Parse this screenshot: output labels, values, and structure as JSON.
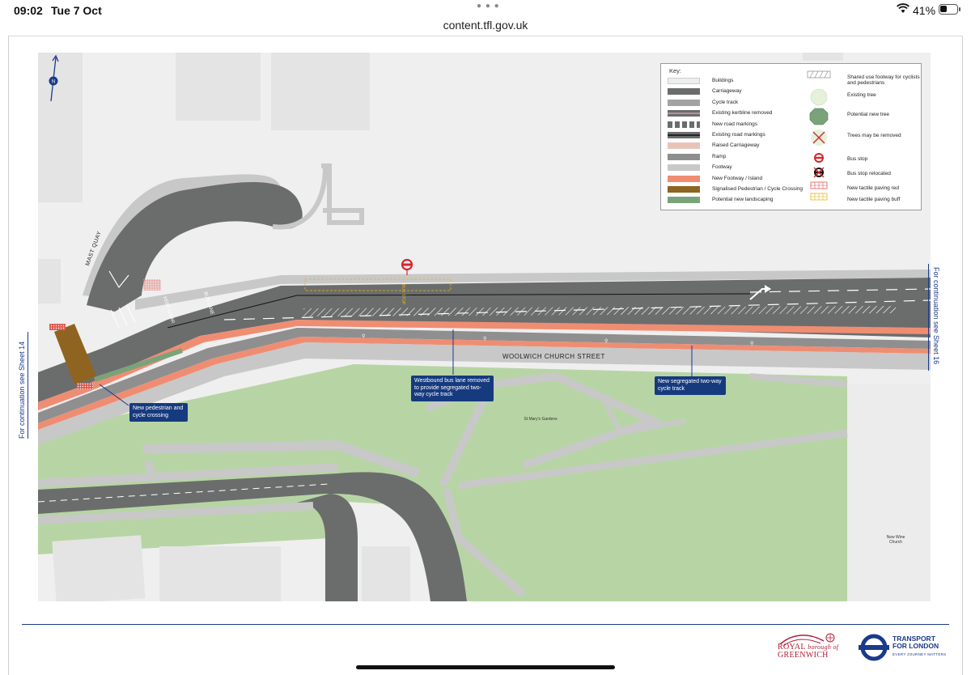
{
  "status_bar": {
    "time": "09:02",
    "date": "Tue 7 Oct",
    "battery": "41%",
    "battery_level": 0.41
  },
  "browser": {
    "url": "content.tfl.gov.uk"
  },
  "map": {
    "continuation_left": "For continuation see Sheet 14",
    "continuation_right": "For continuation see Sheet 16",
    "street_label": "WOOLWICH CHURCH STREET",
    "side_street_label": "MAST QUAY",
    "park_label": "St Mary's Gardens",
    "church_label": "New Wine Church",
    "north_label": "N",
    "road_text": {
      "bus_lane": "BUS LANE",
      "keep_clear": "KEEP CLEAR",
      "bus_stop": "BUS STOP"
    },
    "callouts": {
      "crossing": "New pedestrian and cycle crossing",
      "bus_lane_removed": "Westbound bus lane removed to provide segregated two-way cycle track",
      "cycle_track": "New segregated two-way cycle track"
    }
  },
  "key": {
    "title": "Key:",
    "left": [
      {
        "label": "Buildings",
        "color": "#eeeeee"
      },
      {
        "label": "Carriageway",
        "color": "#6b6d6c"
      },
      {
        "label": "Cycle track",
        "color": "#a3a3a3"
      },
      {
        "label": "Existing kerbline removed",
        "color": "#8e6f79"
      },
      {
        "label": "New road markings",
        "color": "#6b6d6c"
      },
      {
        "label": "Existing road markings",
        "color": "#5a5a5a"
      },
      {
        "label": "Raised Carriageway",
        "color": "#e8c4b8"
      },
      {
        "label": "Ramp",
        "color": "#8e8e8e"
      },
      {
        "label": "Footway",
        "color": "#c8c8c8"
      },
      {
        "label": "New Footway / Island",
        "color": "#ef8d73"
      },
      {
        "label": "Signalised Pedestrian / Cycle Crossing",
        "color": "#8f6420"
      },
      {
        "label": "Potential new landscaping",
        "color": "#7aa37a"
      }
    ],
    "right": [
      {
        "label": "Shared use footway for cyclists and pedestrians",
        "icon": "hatched-footway-icon"
      },
      {
        "label": "Existing tree",
        "icon": "existing-tree-icon"
      },
      {
        "label": "Potential new tree",
        "icon": "new-tree-icon"
      },
      {
        "label": "Trees may be removed",
        "icon": "tree-removed-icon"
      },
      {
        "label": "Bus stop",
        "icon": "bus-stop-icon"
      },
      {
        "label": "Bus stop relocated",
        "icon": "bus-stop-relocated-icon"
      },
      {
        "label": "New tactile paving red",
        "icon": "tactile-red-icon"
      },
      {
        "label": "New tactile paving buff",
        "icon": "tactile-buff-icon"
      }
    ]
  },
  "footer": {
    "rbg_line1": "ROYAL",
    "rbg_line1b": "borough of",
    "rbg_line2": "GREENWICH",
    "tfl_line1": "TRANSPORT",
    "tfl_line2": "FOR LONDON",
    "tfl_tagline": "EVERY JOURNEY MATTERS"
  },
  "colors": {
    "carriageway": "#6b6d6c",
    "footway": "#c8c8c8",
    "new_footway": "#ef8d73",
    "crossing": "#8f6420",
    "grass": "#b7d5a4",
    "building": "#eeeeee",
    "tfl_blue": "#1a3a8a",
    "rbg_red": "#b21e36"
  }
}
